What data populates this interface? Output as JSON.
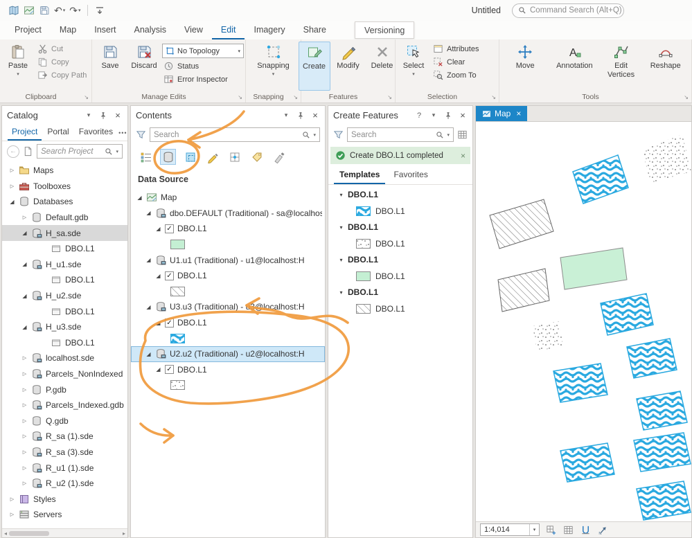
{
  "colors": {
    "accent_blue": "#1265a8",
    "annotation_orange": "#f09a3c",
    "selection_blue": "#cfe8f8",
    "success_green": "#3f9e57",
    "map_tab_blue": "#1d86c8"
  },
  "glyphs": {
    "expand_open": "◢",
    "expand_closed": "▷",
    "caret": "▾",
    "close": "×",
    "back": "←",
    "more": "•••",
    "check": "✓",
    "undo": "↶",
    "redo": "↷",
    "help": "?",
    "launcher": "↘",
    "scroll_left": "◂",
    "scroll_right": "▸"
  },
  "titlebar": {
    "title": "Untitled",
    "command_search": "Command Search (Alt+Q)"
  },
  "ribbon": {
    "tabs": [
      {
        "label": "Project"
      },
      {
        "label": "Map"
      },
      {
        "label": "Insert"
      },
      {
        "label": "Analysis"
      },
      {
        "label": "View"
      },
      {
        "label": "Edit"
      },
      {
        "label": "Imagery"
      },
      {
        "label": "Share"
      },
      {
        "label": "Versioning"
      }
    ],
    "clipboard": {
      "group": "Clipboard",
      "paste": "Paste",
      "cut": "Cut",
      "copy": "Copy",
      "copy_path": "Copy Path"
    },
    "manage_edits": {
      "group": "Manage Edits",
      "save": "Save",
      "discard": "Discard",
      "topology": "No Topology",
      "status": "Status",
      "error_inspector": "Error Inspector"
    },
    "snapping": {
      "group": "Snapping",
      "snapping": "Snapping"
    },
    "features": {
      "group": "Features",
      "create": "Create",
      "modify": "Modify",
      "delete": "Delete"
    },
    "selection": {
      "group": "Selection",
      "select": "Select",
      "attributes": "Attributes",
      "clear": "Clear",
      "zoom_to": "Zoom To"
    },
    "tools": {
      "group": "Tools",
      "move": "Move",
      "annotation": "Annotation",
      "edit_vertices": "Edit Vertices",
      "reshape": "Reshape"
    }
  },
  "catalog": {
    "title": "Catalog",
    "tabs": [
      {
        "label": "Project"
      },
      {
        "label": "Portal"
      },
      {
        "label": "Favorites"
      }
    ],
    "search_placeholder": "Search Project",
    "tree": [
      {
        "label": "Maps"
      },
      {
        "label": "Toolboxes"
      },
      {
        "label": "Databases"
      },
      {
        "label": "Default.gdb"
      },
      {
        "label": "H_sa.sde"
      },
      {
        "label": "DBO.L1"
      },
      {
        "label": "H_u1.sde"
      },
      {
        "label": "DBO.L1"
      },
      {
        "label": "H_u2.sde"
      },
      {
        "label": "DBO.L1"
      },
      {
        "label": "H_u3.sde"
      },
      {
        "label": "DBO.L1"
      },
      {
        "label": "localhost.sde"
      },
      {
        "label": "Parcels_NonIndexed"
      },
      {
        "label": "P.gdb"
      },
      {
        "label": "Parcels_Indexed.gdb"
      },
      {
        "label": "Q.gdb"
      },
      {
        "label": "R_sa (1).sde"
      },
      {
        "label": "R_sa (3).sde"
      },
      {
        "label": "R_u1 (1).sde"
      },
      {
        "label": "R_u2 (1).sde"
      },
      {
        "label": "Styles"
      },
      {
        "label": "Servers"
      }
    ]
  },
  "contents": {
    "title": "Contents",
    "search_placeholder": "Search",
    "heading": "Data Source",
    "map_label": "Map",
    "connections": [
      {
        "label": "dbo.DEFAULT (Traditional) - sa@localhost:H",
        "layer": "DBO.L1",
        "symbol": "green-fill"
      },
      {
        "label": "U1.u1 (Traditional) - u1@localhost:H",
        "layer": "DBO.L1",
        "symbol": "diagonal-hatch"
      },
      {
        "label": "U3.u3 (Traditional) - u3@localhost:H",
        "layer": "DBO.L1",
        "symbol": "blue-coral-pattern"
      },
      {
        "label": "U2.u2 (Traditional) - u2@localhost:H",
        "layer": "DBO.L1",
        "symbol": "dot-pattern",
        "selected": true
      }
    ]
  },
  "create_features": {
    "title": "Create Features",
    "search_placeholder": "Search",
    "notification": "Create DBO.L1 completed",
    "tabs": [
      {
        "label": "Templates"
      },
      {
        "label": "Favorites"
      }
    ],
    "groups": [
      {
        "header": "DBO.L1",
        "item": "DBO.L1",
        "symbol": "blue-coral-pattern"
      },
      {
        "header": "DBO.L1",
        "item": "DBO.L1",
        "symbol": "dot-pattern"
      },
      {
        "header": "DBO.L1",
        "item": "DBO.L1",
        "symbol": "green-fill"
      },
      {
        "header": "DBO.L1",
        "item": "DBO.L1",
        "symbol": "diagonal-hatch"
      }
    ]
  },
  "map_view": {
    "tab": "Map",
    "scale": "1:4,014"
  }
}
